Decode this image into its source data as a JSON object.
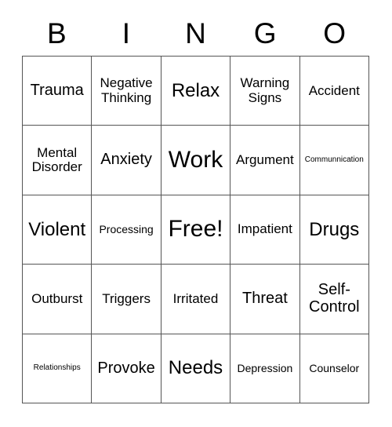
{
  "card": {
    "header_letters": [
      "B",
      "I",
      "N",
      "G",
      "O"
    ],
    "grid": {
      "rows": 5,
      "columns": 5,
      "border_color": "#555555",
      "cell_background": "#ffffff",
      "text_color": "#000000"
    },
    "cells": [
      {
        "text": "Trauma",
        "size": "lg"
      },
      {
        "text": "Negative Thinking",
        "size": "md"
      },
      {
        "text": "Relax",
        "size": "xl"
      },
      {
        "text": "Warning Signs",
        "size": "md"
      },
      {
        "text": "Accident",
        "size": "md"
      },
      {
        "text": "Mental Disorder",
        "size": "md"
      },
      {
        "text": "Anxiety",
        "size": "lg"
      },
      {
        "text": "Work",
        "size": "xxl"
      },
      {
        "text": "Argument",
        "size": "md"
      },
      {
        "text": "Communnication",
        "size": "xs"
      },
      {
        "text": "Violent",
        "size": "xl"
      },
      {
        "text": "Processing",
        "size": "sm"
      },
      {
        "text": "Free!",
        "size": "xxl"
      },
      {
        "text": "Impatient",
        "size": "md"
      },
      {
        "text": "Drugs",
        "size": "xl"
      },
      {
        "text": "Outburst",
        "size": "md"
      },
      {
        "text": "Triggers",
        "size": "md"
      },
      {
        "text": "Irritated",
        "size": "md"
      },
      {
        "text": "Threat",
        "size": "lg"
      },
      {
        "text": "Self-Control",
        "size": "lg"
      },
      {
        "text": "Relationships",
        "size": "xs"
      },
      {
        "text": "Provoke",
        "size": "lg"
      },
      {
        "text": "Needs",
        "size": "xl"
      },
      {
        "text": "Depression",
        "size": "sm"
      },
      {
        "text": "Counselor",
        "size": "sm"
      }
    ]
  }
}
